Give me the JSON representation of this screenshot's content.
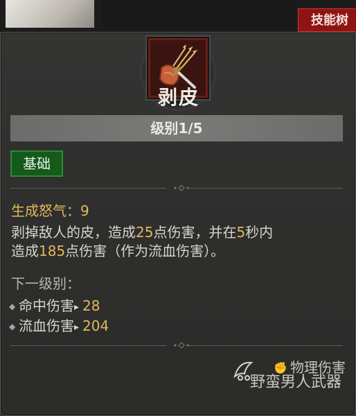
{
  "background": {
    "top_button_label": "技能树"
  },
  "skill": {
    "icon": "arrow-quiver-dagger-icon",
    "name": "剥皮",
    "level_label": "级别1/5",
    "tag": "基础",
    "resource_label": "生成怒气：",
    "resource_value": "9",
    "description": {
      "part1": "剥掉敌人的皮，造成",
      "value1": "25",
      "part2": "点伤害，并在",
      "value2": "5",
      "part3": "秒内",
      "part4": "造成",
      "value3": "185",
      "part5": "点伤害（作为流血伤害）。"
    },
    "next_level_label": "下一级别：",
    "upgrades": [
      {
        "label": "命中伤害",
        "value": "28"
      },
      {
        "label": "流血伤害",
        "value": "204"
      }
    ],
    "damage_type": "物理伤害"
  },
  "watermark": "野蛮男人武器",
  "colors": {
    "highlight": "#e1b95a",
    "tag_green": "#155a1b",
    "title_red": "#8e1414"
  }
}
